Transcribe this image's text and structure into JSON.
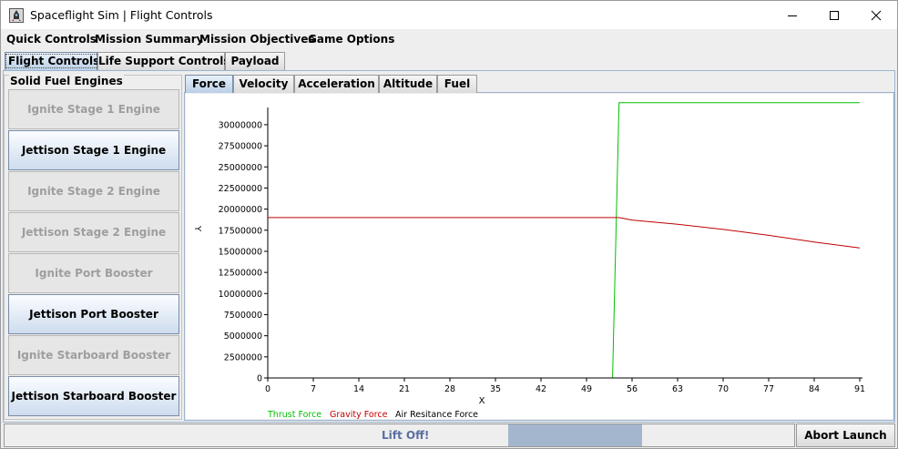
{
  "window": {
    "title": "Spaceflight Sim | Flight Controls"
  },
  "icons": {
    "app": "rocket-icon",
    "minimize": "minimize-icon",
    "maximize": "maximize-icon",
    "close": "close-icon"
  },
  "menu": {
    "items": [
      "Quick Controls",
      "Mission Summary",
      "Mission Objectives",
      "Game Options"
    ]
  },
  "main_tabs": [
    {
      "label": "Flight Controls",
      "selected": true
    },
    {
      "label": "Life Support Controls",
      "selected": false
    },
    {
      "label": "Payload",
      "selected": false
    }
  ],
  "engines": {
    "title": "Solid Fuel Engines",
    "buttons": [
      {
        "label": "Ignite Stage 1 Engine",
        "enabled": false
      },
      {
        "label": "Jettison Stage 1 Engine",
        "enabled": true
      },
      {
        "label": "Ignite Stage 2 Engine",
        "enabled": false
      },
      {
        "label": "Jettison Stage 2 Engine",
        "enabled": false
      },
      {
        "label": "Ignite Port Booster",
        "enabled": false
      },
      {
        "label": "Jettison Port Booster",
        "enabled": true
      },
      {
        "label": "Ignite Starboard Booster",
        "enabled": false
      },
      {
        "label": "Jettison Starboard Booster",
        "enabled": true
      }
    ]
  },
  "chart_tabs": [
    {
      "label": "Force",
      "selected": true
    },
    {
      "label": "Velocity",
      "selected": false
    },
    {
      "label": "Acceleration",
      "selected": false
    },
    {
      "label": "Altitude",
      "selected": false
    },
    {
      "label": "Fuel",
      "selected": false
    }
  ],
  "chart_data": {
    "type": "line",
    "title": "",
    "xlabel": "X",
    "ylabel": "Y",
    "xlim": [
      0,
      91
    ],
    "ylim": [
      0,
      31500000
    ],
    "x_ticks": [
      0,
      7,
      14,
      21,
      28,
      35,
      42,
      49,
      56,
      63,
      70,
      77,
      84,
      91
    ],
    "y_ticks": [
      0,
      2500000,
      5000000,
      7500000,
      10000000,
      12500000,
      15000000,
      17500000,
      20000000,
      22500000,
      25000000,
      27500000,
      30000000
    ],
    "y_tick_labels": [
      "0",
      "2500000",
      "5000000",
      "7500000",
      "10000000",
      "12500000",
      "15000000",
      "17500000",
      "20000000",
      "22500000",
      "25000000",
      "27500000",
      "30000000"
    ],
    "grid": false,
    "legend": "bottom-left",
    "series": [
      {
        "name": "Thrust Force",
        "color": "#00c000",
        "points": [
          [
            0,
            0
          ],
          [
            53,
            0
          ],
          [
            54,
            32600000
          ],
          [
            91,
            32600000
          ]
        ]
      },
      {
        "name": "Gravity Force",
        "color": "#c00000",
        "points": [
          [
            0,
            19000000
          ],
          [
            54,
            19000000
          ],
          [
            56,
            18700000
          ],
          [
            63,
            18200000
          ],
          [
            70,
            17600000
          ],
          [
            77,
            16900000
          ],
          [
            84,
            16100000
          ],
          [
            91,
            15400000
          ]
        ]
      },
      {
        "name": "Air Resitance Force",
        "color": "#000000",
        "points": [
          [
            0,
            0
          ],
          [
            91,
            0
          ]
        ]
      }
    ]
  },
  "bottom": {
    "status_label": "Lift Off!",
    "progress": 0.17,
    "abort_label": "Abort Launch"
  }
}
